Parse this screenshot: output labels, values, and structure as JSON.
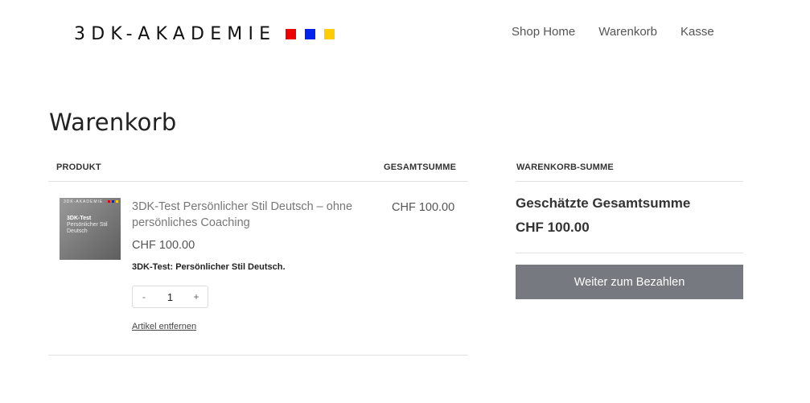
{
  "header": {
    "logo_text": "3DK-AKADEMIE",
    "logo_colors": [
      "#ee0000",
      "#0022ee",
      "#ffcc00"
    ],
    "nav": [
      "Shop Home",
      "Warenkorb",
      "Kasse"
    ]
  },
  "page": {
    "title": "Warenkorb"
  },
  "cart": {
    "col_product": "PRODUKT",
    "col_total": "GESAMTSUMME",
    "item": {
      "thumb_top": "3DK-AKADEMIE",
      "thumb_line1": "3DK-Test",
      "thumb_line2": "Persönlicher Stil",
      "thumb_line3": "Deutsch",
      "name": "3DK-Test Persönlicher Stil Deutsch – ohne persönliches Coaching",
      "price": "CHF 100.00",
      "description": "3DK-Test: Persönlicher Stil Deutsch.",
      "quantity": "1",
      "decrement": "-",
      "increment": "+",
      "remove": "Artikel entfernen",
      "line_total": "CHF 100.00"
    }
  },
  "summary": {
    "heading": "WARENKORB-SUMME",
    "estimated_label": "Geschätzte Gesamtsumme",
    "estimated_value": "CHF 100.00",
    "checkout_button": "Weiter zum Bezahlen",
    "button_color": "#767a80"
  }
}
